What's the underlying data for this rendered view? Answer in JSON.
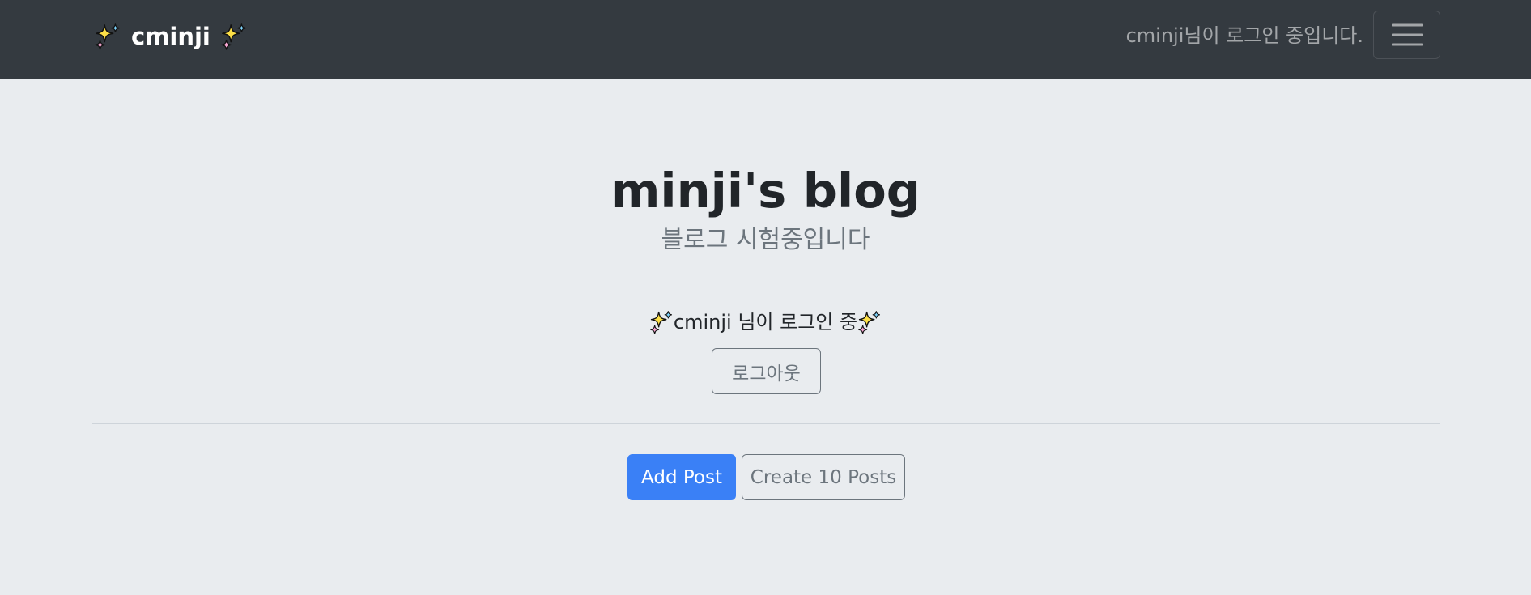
{
  "navbar": {
    "brand": "cminji",
    "brand_left_icon": "sparkles-icon",
    "brand_right_icon": "sparkles-icon",
    "status_text": "cminji님이 로그인 중입니다.",
    "menu_icon": "hamburger-menu-icon"
  },
  "hero": {
    "title": "minji's blog",
    "subtitle": "블로그 시험중입니다"
  },
  "login": {
    "message": "cminji 님이 로그인 중",
    "icon": "sparkles-icon",
    "logout_label": "로그아웃"
  },
  "actions": {
    "add_post_label": "Add Post",
    "create_posts_label": "Create 10 Posts"
  },
  "colors": {
    "navbar_bg": "#343a40",
    "page_bg": "#e9ecef",
    "primary": "#3a80f6",
    "muted": "#6c757d",
    "sparkle": "#fde047"
  }
}
